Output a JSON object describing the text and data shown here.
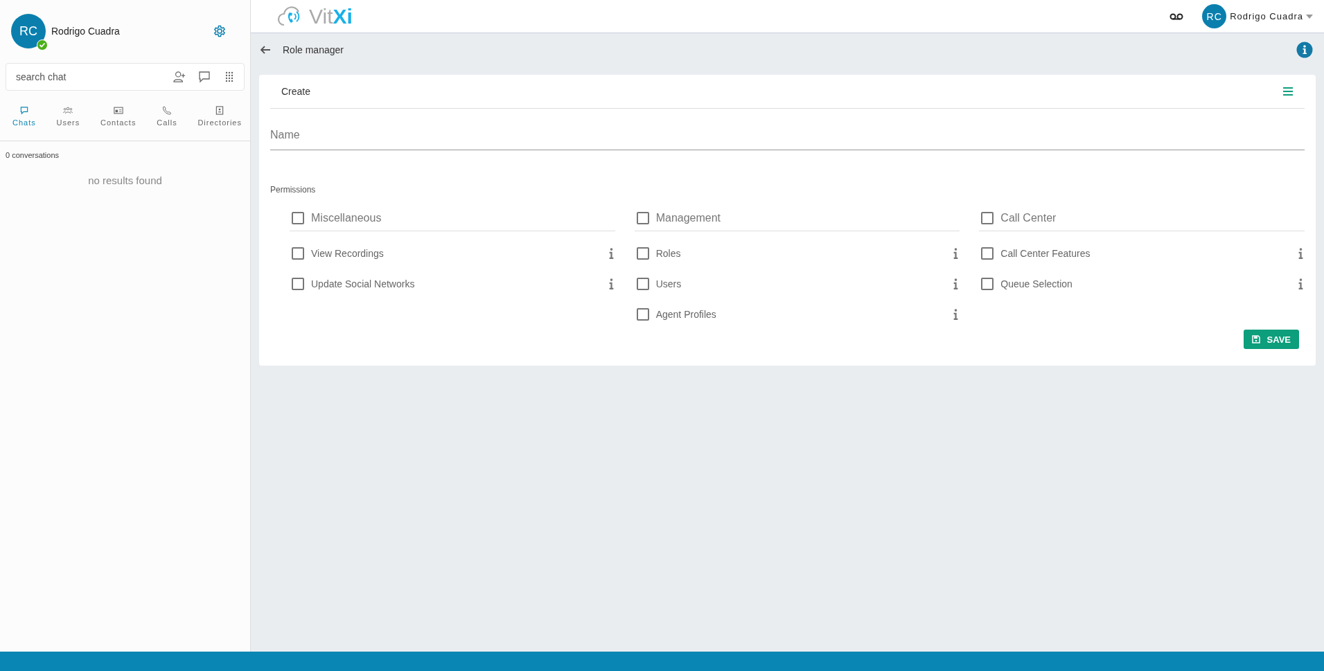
{
  "sidebar": {
    "user": {
      "initials": "RC",
      "name": "Rodrigo Cuadra",
      "online": true
    },
    "search": {
      "placeholder": "search chat"
    },
    "tabs": [
      {
        "label": "Chats",
        "selected": true,
        "kind": "chat"
      },
      {
        "label": "Users",
        "selected": false,
        "kind": "users"
      },
      {
        "label": "Contacts",
        "selected": false,
        "kind": "contacts"
      },
      {
        "label": "Calls",
        "selected": false,
        "kind": "calls"
      },
      {
        "label": "Directories",
        "selected": false,
        "kind": "directories"
      }
    ],
    "conversation_count": "0 conversations",
    "empty_message": "no results found"
  },
  "header": {
    "logo": [
      "Vit",
      "Xi"
    ],
    "user": {
      "initials": "RC",
      "name": "Rodrigo Cuadra"
    }
  },
  "breadcrumb": {
    "title": "Role manager"
  },
  "card": {
    "tab": "Create",
    "name_field": {
      "placeholder": "Name"
    },
    "permissions_label": "Permissions",
    "groups": [
      {
        "label": "Miscellaneous",
        "checked": false,
        "items": [
          {
            "label": "View Recordings",
            "checked": false
          },
          {
            "label": "Update Social Networks",
            "checked": false
          }
        ]
      },
      {
        "label": "Management",
        "checked": false,
        "items": [
          {
            "label": "Roles",
            "checked": false
          },
          {
            "label": "Users",
            "checked": false
          },
          {
            "label": "Agent Profiles",
            "checked": false
          }
        ]
      },
      {
        "label": "Call Center",
        "checked": false,
        "items": [
          {
            "label": "Call Center Features",
            "checked": false
          },
          {
            "label": "Queue Selection",
            "checked": false
          }
        ]
      }
    ],
    "save_button": "SAVE"
  }
}
